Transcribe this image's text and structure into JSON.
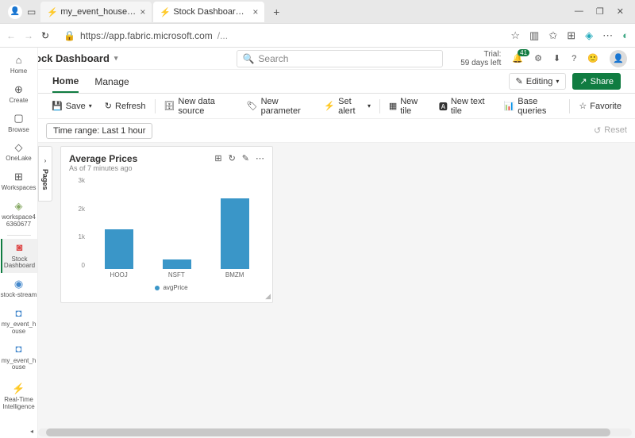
{
  "browser": {
    "tabs": [
      {
        "title": "my_event_house - Real-Time Inte"
      },
      {
        "title": "Stock Dashboard - Real-Time Inte"
      }
    ],
    "url": "https://app.fabric.microsoft.com",
    "url_path": "/..."
  },
  "app": {
    "title": "Stock Dashboard",
    "search_placeholder": "Search",
    "trial_label": "Trial:",
    "trial_days": "59 days left",
    "notif_count": "41"
  },
  "menu": {
    "home": "Home",
    "manage": "Manage",
    "editing": "Editing",
    "share": "Share"
  },
  "toolbar": {
    "save": "Save",
    "refresh": "Refresh",
    "new_data_source": "New data source",
    "new_parameter": "New parameter",
    "set_alert": "Set alert",
    "new_tile": "New tile",
    "new_text_tile": "New text tile",
    "base_queries": "Base queries",
    "favorite": "Favorite"
  },
  "time_range": {
    "label": "Time range: Last 1 hour",
    "reset": "Reset"
  },
  "rail": {
    "home": "Home",
    "create": "Create",
    "browse": "Browse",
    "onelake": "OneLake",
    "workspaces": "Workspaces",
    "workspace4": "workspace46360677",
    "stock_dashboard": "Stock Dashboard",
    "stock_stream": "stock-stream",
    "my_event_house1": "my_event_house",
    "my_event_house2": "my_event_house",
    "rti": "Real-Time Intelligence"
  },
  "pages": {
    "label": "Pages"
  },
  "tile": {
    "title": "Average Prices",
    "subtitle": "As of 7 minutes ago"
  },
  "chart_data": {
    "type": "bar",
    "title": "Average Prices",
    "categories": [
      "HOOJ",
      "NSFT",
      "BMZM"
    ],
    "values": [
      1300,
      300,
      2300
    ],
    "series_name": "avgPrice",
    "ylabel": "",
    "xlabel": "",
    "ylim": [
      0,
      3000
    ],
    "yticks": [
      "0",
      "1k",
      "2k",
      "3k"
    ]
  }
}
